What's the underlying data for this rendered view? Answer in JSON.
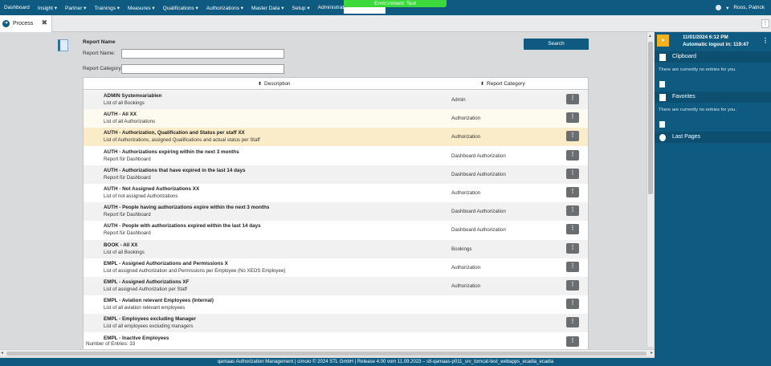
{
  "nav": {
    "items": [
      "Dashboard",
      "Insight",
      "Partner",
      "Trainings",
      "Measures",
      "Qualifications",
      "Authorizations",
      "Master Data",
      "Setup",
      "Administration"
    ],
    "environment": "Environment: Test",
    "user": "Roos, Patrick"
  },
  "tabs": {
    "process_label": "Process"
  },
  "form": {
    "title": "Report Name",
    "name_label": "Report Name:",
    "name_value": "",
    "category_label": "Report Category:",
    "category_value": "",
    "search_label": "Search"
  },
  "table": {
    "headers": {
      "description": "Description",
      "category": "Report Category"
    },
    "rows": [
      {
        "title": "ADMIN Systemvariablen",
        "sub": "List of all Bookings",
        "cat": "Admin"
      },
      {
        "title": "AUTH - All XX",
        "sub": "List of all Authorizations",
        "cat": "Authorization"
      },
      {
        "title": "AUTH - Authorization, Qualification and Status per staff XX",
        "sub": "List of Authorizations, assigned Qualifications and actual status per Staff",
        "cat": "Authorization"
      },
      {
        "title": "AUTH - Authorizations expiring within the next 3 months",
        "sub": "Report für Dashboard",
        "cat": "Dashboard Authorization"
      },
      {
        "title": "AUTH - Authorizations that have expired in the last 14 days",
        "sub": "Report für Dashboard",
        "cat": "Dashboard Authorization"
      },
      {
        "title": "AUTH - Not Assigned Authorizations XX",
        "sub": "List of not assigned Authorizations",
        "cat": "Authorization"
      },
      {
        "title": "AUTH - People having authorizations expire within the next 3 months",
        "sub": "Report für Dashboard",
        "cat": "Dashboard Authorization"
      },
      {
        "title": "AUTH - People with authorizations expired within the last 14 days",
        "sub": "Report für Dashboard",
        "cat": "Dashboard Authorization"
      },
      {
        "title": "BOOK - All XX",
        "sub": "List of all Bookings",
        "cat": "Bookings"
      },
      {
        "title": "EMPL - Assigned Authorizations and Permissions X",
        "sub": "List of assigned Authorization and Permissions per Employee (No XEOS Employee)",
        "cat": "Authorization"
      },
      {
        "title": "EMPL - Assigned Authorizations XF",
        "sub": "List of assigned Authorization per Staff",
        "cat": "Authorization"
      },
      {
        "title": "EMPL - Aviation relevant Employees (Internal)",
        "sub": "List of all aviation relevant employees",
        "cat": ""
      },
      {
        "title": "EMPL - Employees excluding Manager",
        "sub": "List of all employees excluding managers",
        "cat": ""
      },
      {
        "title": "EMPL - Inactive Employees",
        "sub": "",
        "cat": ""
      }
    ],
    "count_label": "Number of Entries: 33"
  },
  "side": {
    "date": "11/01/2024 6:12 PM",
    "logout": "Automatic logout in: 119:47",
    "clipboard": "Clipboard",
    "favorites": "Favorites",
    "last_pages": "Last Pages",
    "empty_text": "There are currently no entries for you."
  },
  "footer": "qamaas Authorization Management | cimoio © 2024 STL GmbH | Release 4.00 vom 11.09.2023 – stl-qamaas-p011_srv_tomcat-test_webapps_ecadia_ecadia"
}
